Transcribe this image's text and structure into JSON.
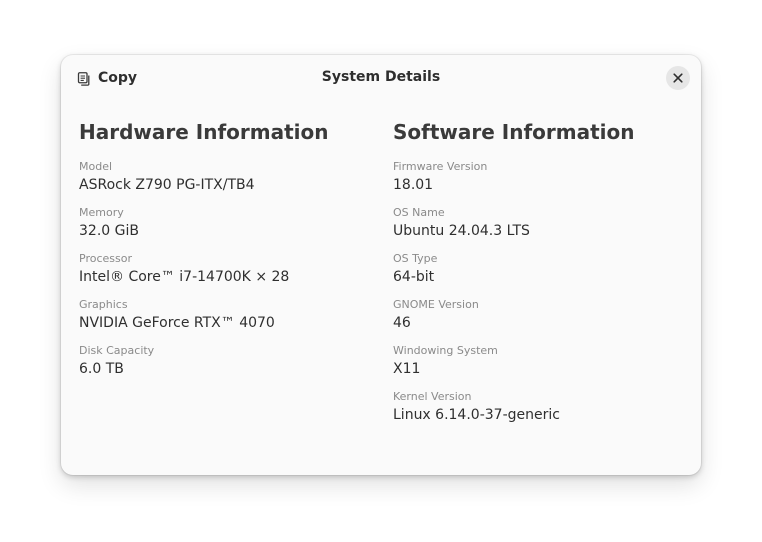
{
  "header": {
    "copy_label": "Copy",
    "copy_icon": "copy-icon",
    "title": "System Details",
    "close_icon": "close-icon"
  },
  "hardware": {
    "title": "Hardware Information",
    "fields": [
      {
        "label": "Model",
        "value": "ASRock Z790 PG-ITX/TB4"
      },
      {
        "label": "Memory",
        "value": "32.0 GiB"
      },
      {
        "label": "Processor",
        "value": "Intel® Core™ i7-14700K × 28"
      },
      {
        "label": "Graphics",
        "value": "NVIDIA GeForce RTX™ 4070"
      },
      {
        "label": "Disk Capacity",
        "value": "6.0 TB"
      }
    ]
  },
  "software": {
    "title": "Software Information",
    "fields": [
      {
        "label": "Firmware Version",
        "value": "18.01"
      },
      {
        "label": "OS Name",
        "value": "Ubuntu 24.04.3 LTS"
      },
      {
        "label": "OS Type",
        "value": "64-bit"
      },
      {
        "label": "GNOME Version",
        "value": "46"
      },
      {
        "label": "Windowing System",
        "value": "X11"
      },
      {
        "label": "Kernel Version",
        "value": "Linux 6.14.0-37-generic"
      }
    ]
  }
}
